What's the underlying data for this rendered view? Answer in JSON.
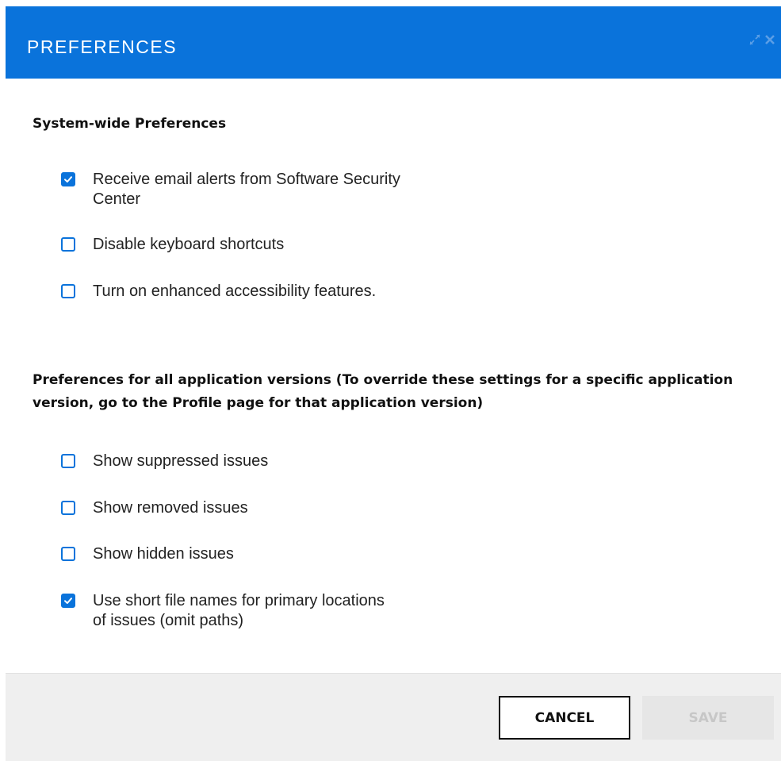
{
  "dialog": {
    "title": "PREFERENCES",
    "accent_color": "#0a73db",
    "header_icons": [
      "expand-icon",
      "close-icon"
    ]
  },
  "system_section": {
    "title": "System-wide Preferences",
    "options": [
      {
        "label": "Receive email alerts from Software Security Center",
        "checked": true
      },
      {
        "label": "Disable keyboard shortcuts",
        "checked": false
      },
      {
        "label": "Turn on enhanced accessibility features.",
        "checked": false
      }
    ]
  },
  "app_section": {
    "title": "Preferences for all application versions (To override these settings for a specific application version, go to the Profile page for that application version)",
    "options": [
      {
        "label": "Show suppressed issues",
        "checked": false
      },
      {
        "label": "Show removed issues",
        "checked": false
      },
      {
        "label": "Show hidden issues",
        "checked": false
      },
      {
        "label": "Use short file names for primary locations of issues (omit paths)",
        "checked": true
      }
    ]
  },
  "footer": {
    "cancel_label": "CANCEL",
    "save_label": "SAVE",
    "save_enabled": false
  }
}
